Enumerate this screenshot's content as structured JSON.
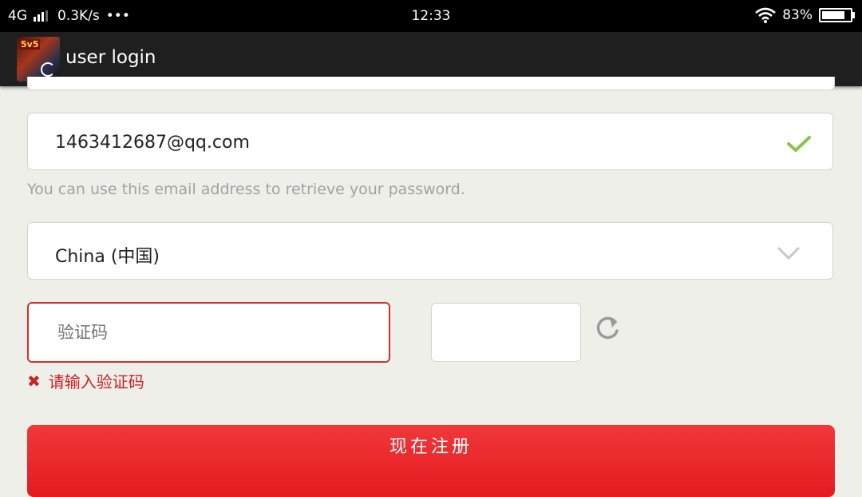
{
  "status_bar": {
    "network": "4G",
    "speed": "0.3K/s",
    "more": "•••",
    "time": "12:33",
    "battery_percent": "83%",
    "battery_level": 0.83
  },
  "app_bar": {
    "logo_text": "5v5",
    "title": "user login"
  },
  "form": {
    "email": {
      "value": "1463412687@qq.com",
      "valid_icon": "checkmark-icon",
      "valid_color": "#8bc34a"
    },
    "email_hint": "You can use this email address to retrieve your password.",
    "country": {
      "value": "China (中国)",
      "icon": "chevron-down-icon"
    },
    "captcha": {
      "placeholder": "验证码",
      "value": ""
    },
    "refresh_icon": "refresh-icon",
    "error": {
      "icon": "error-x-icon",
      "message": "请输入验证码",
      "color": "#cc2222"
    },
    "submit_label": "现在注册",
    "accent_color": "#e8242a"
  }
}
